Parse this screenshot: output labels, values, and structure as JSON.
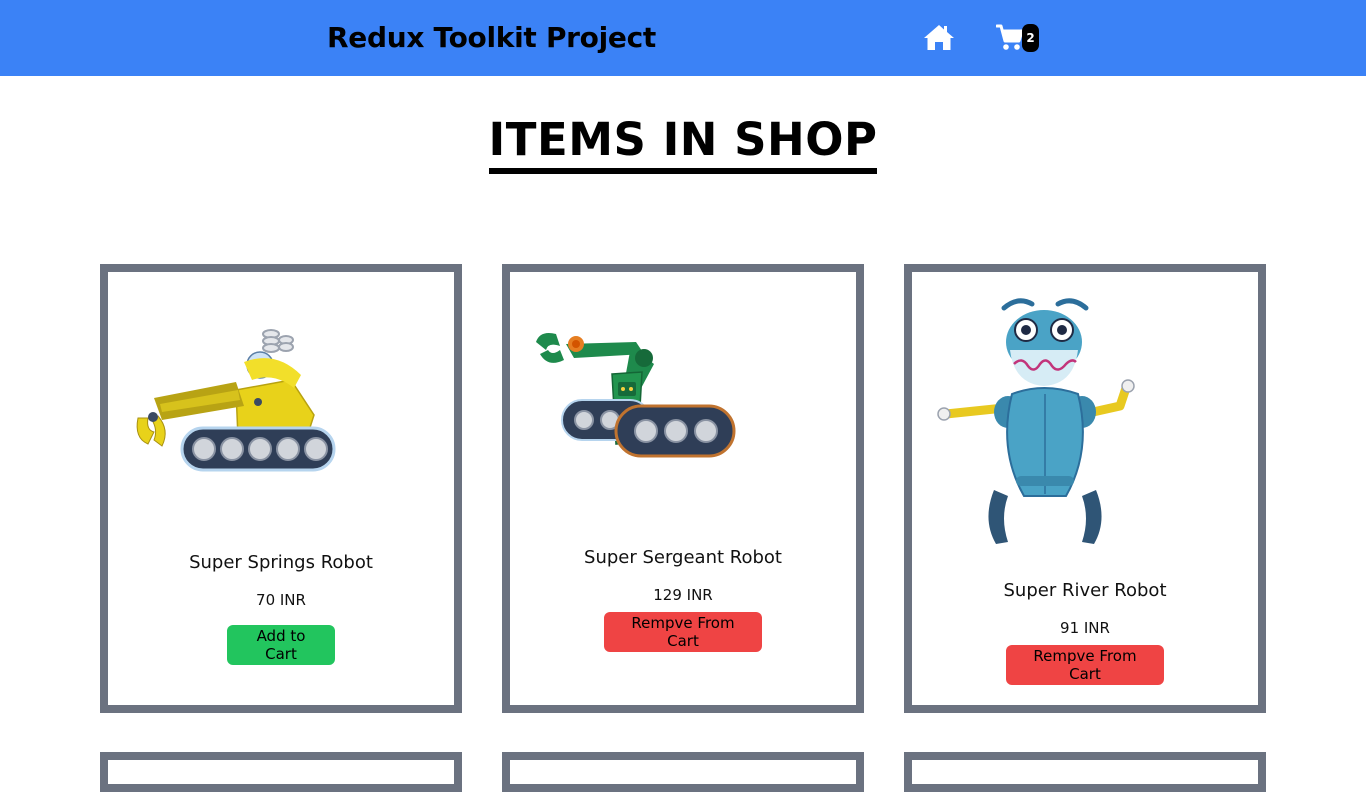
{
  "navbar": {
    "title": "Redux Toolkit Project",
    "home_icon": "home-icon",
    "cart_icon": "cart-icon",
    "cart_count": "2",
    "colors": {
      "background": "#3b82f6",
      "badge": "#000000"
    }
  },
  "page": {
    "heading": "ITEMS IN SHOP"
  },
  "products": [
    {
      "name": "Super Springs Robot",
      "price": "70 INR",
      "button_label": "Add to Cart",
      "in_cart": false
    },
    {
      "name": "Super Sergeant Robot",
      "price": "129 INR",
      "button_label": "Rempve From Cart",
      "in_cart": true
    },
    {
      "name": "Super River Robot",
      "price": "91 INR",
      "button_label": "Rempve From Cart",
      "in_cart": true
    }
  ],
  "colors": {
    "card_border": "#6b7280",
    "add_button": "#22c55e",
    "remove_button": "#ef4444"
  }
}
